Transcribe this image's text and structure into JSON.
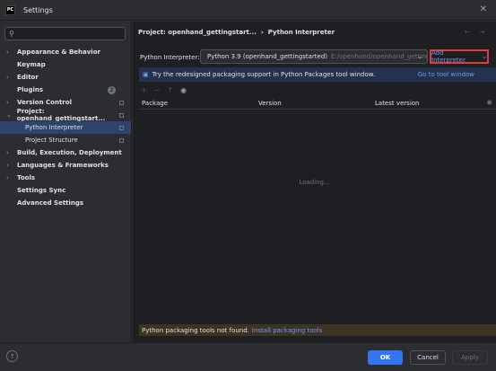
{
  "window": {
    "title": "Settings",
    "app_icon_text": "PC"
  },
  "search": {
    "placeholder": ""
  },
  "sidebar": {
    "items": [
      {
        "label": "Appearance & Behavior",
        "arrow": "›"
      },
      {
        "label": "Keymap",
        "arrow": ""
      },
      {
        "label": "Editor",
        "arrow": "›"
      },
      {
        "label": "Plugins",
        "arrow": ""
      },
      {
        "label": "Version Control",
        "arrow": "›"
      },
      {
        "label": "Project: openhand_gettingstart...",
        "arrow": "⌄"
      },
      {
        "label": "Python Interpreter",
        "arrow": ""
      },
      {
        "label": "Project Structure",
        "arrow": ""
      },
      {
        "label": "Build, Execution, Deployment",
        "arrow": "›"
      },
      {
        "label": "Languages & Frameworks",
        "arrow": "›"
      },
      {
        "label": "Tools",
        "arrow": "›"
      },
      {
        "label": "Settings Sync",
        "arrow": ""
      },
      {
        "label": "Advanced Settings",
        "arrow": ""
      }
    ],
    "plugins_badge": "2"
  },
  "breadcrumb": {
    "project": "Project: openhand_gettingstart...",
    "separator": "›",
    "page": "Python Interpreter"
  },
  "interpreter": {
    "label": "Python Interpreter:",
    "name": "Python 3.9 (openhand_gettingstarted)",
    "path": "E:/openhand/openhand_gettingst",
    "add_button": "Add Interpreter"
  },
  "banner": {
    "text": "Try the redesigned packaging support in Python Packages tool window.",
    "link": "Go to tool window"
  },
  "table": {
    "columns": [
      "Package",
      "Version",
      "Latest version"
    ],
    "loading": "Loading..."
  },
  "footer_message": {
    "text": "Python packaging tools not found.",
    "link": "Install packaging tools"
  },
  "buttons": {
    "ok": "OK",
    "cancel": "Cancel",
    "apply": "Apply",
    "help": "?"
  },
  "colors": {
    "accent": "#3574f0",
    "link": "#6d9df2",
    "highlight_border": "#e03c3c",
    "selected": "#2e436e"
  }
}
